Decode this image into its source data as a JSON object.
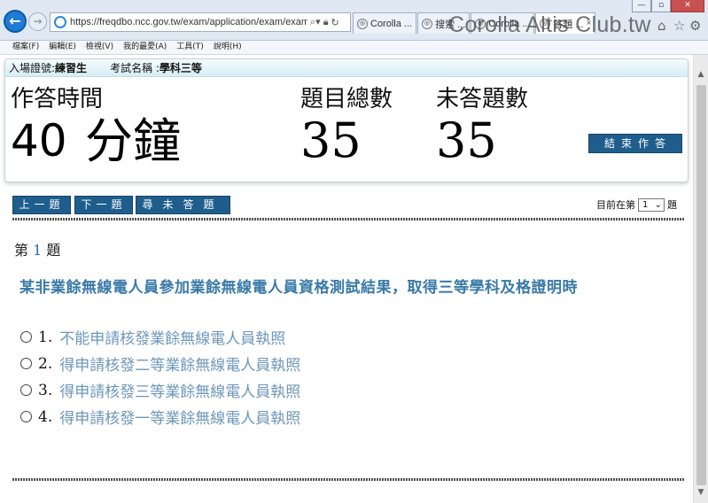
{
  "browser": {
    "url": "https://freqdbo.ncc.gov.tw/exam/application/exam/examcC",
    "tabs": [
      {
        "label": "Corolla ..."
      },
      {
        "label": "搜索 ..."
      },
      {
        "label": "Corolla ..."
      },
      {
        "label": "答題 ..."
      }
    ],
    "active_tab_close": "×",
    "menu": [
      "檔案(F)",
      "編輯(E)",
      "檢視(V)",
      "我的最愛(A)",
      "工具(T)",
      "說明(H)"
    ],
    "watermark": "Corolla Altis Club.tw"
  },
  "exam": {
    "admission_label": "入場證號:",
    "admission_value": "練習生",
    "exam_name_label": "考試名稱 :",
    "exam_name_value": "學科三等",
    "time_label": "作答時間",
    "time_value": "40",
    "time_unit": "分鐘",
    "total_label": "題目總數",
    "total_value": "35",
    "unanswered_label": "未答題數",
    "unanswered_value": "35",
    "end_button": "結束作答"
  },
  "nav": {
    "prev": "上一題",
    "next": "下一題",
    "find_unanswered": "尋未答題",
    "current_prefix": "目前在第",
    "current_value": "1",
    "current_suffix": "題"
  },
  "question": {
    "prefix": "第",
    "number": "1",
    "suffix": "題",
    "text": "某非業餘無線電人員參加業餘無線電人員資格測試結果，取得三等學科及格證明時",
    "options": [
      {
        "num": "1.",
        "text": "不能申請核發業餘無線電人員執照"
      },
      {
        "num": "2.",
        "text": "得申請核發二等業餘無線電人員執照"
      },
      {
        "num": "3.",
        "text": "得申請核發三等業餘無線電人員執照"
      },
      {
        "num": "4.",
        "text": "得申請核發一等業餘無線電人員執照"
      }
    ]
  },
  "colors": {
    "button_bg": "#1f5e8c",
    "question_text": "#3a7aa8",
    "option_text": "#6d97b9"
  }
}
